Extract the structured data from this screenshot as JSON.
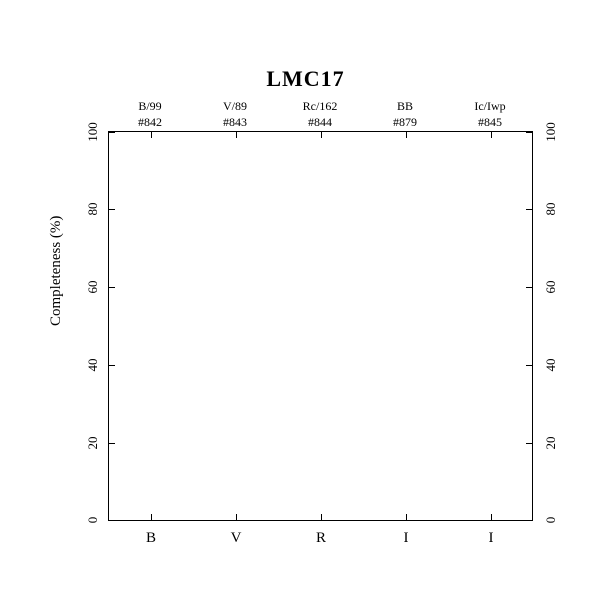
{
  "chart_data": {
    "type": "bar",
    "title": "LMC17",
    "ylabel": "Completeness (%)",
    "ylim": [
      0,
      100
    ],
    "yticks": [
      0,
      20,
      40,
      60,
      80,
      100
    ],
    "categories": [
      "B",
      "V",
      "R",
      "I",
      "I"
    ],
    "series": [
      {
        "name": "completeness",
        "values": [
          null,
          null,
          null,
          null,
          null
        ]
      }
    ],
    "column_headers_top": [
      "B/99",
      "V/89",
      "Rc/162",
      "BB",
      "Ic/Iwp"
    ],
    "column_headers_bottom": [
      "#842",
      "#843",
      "#844",
      "#879",
      "#845"
    ]
  }
}
